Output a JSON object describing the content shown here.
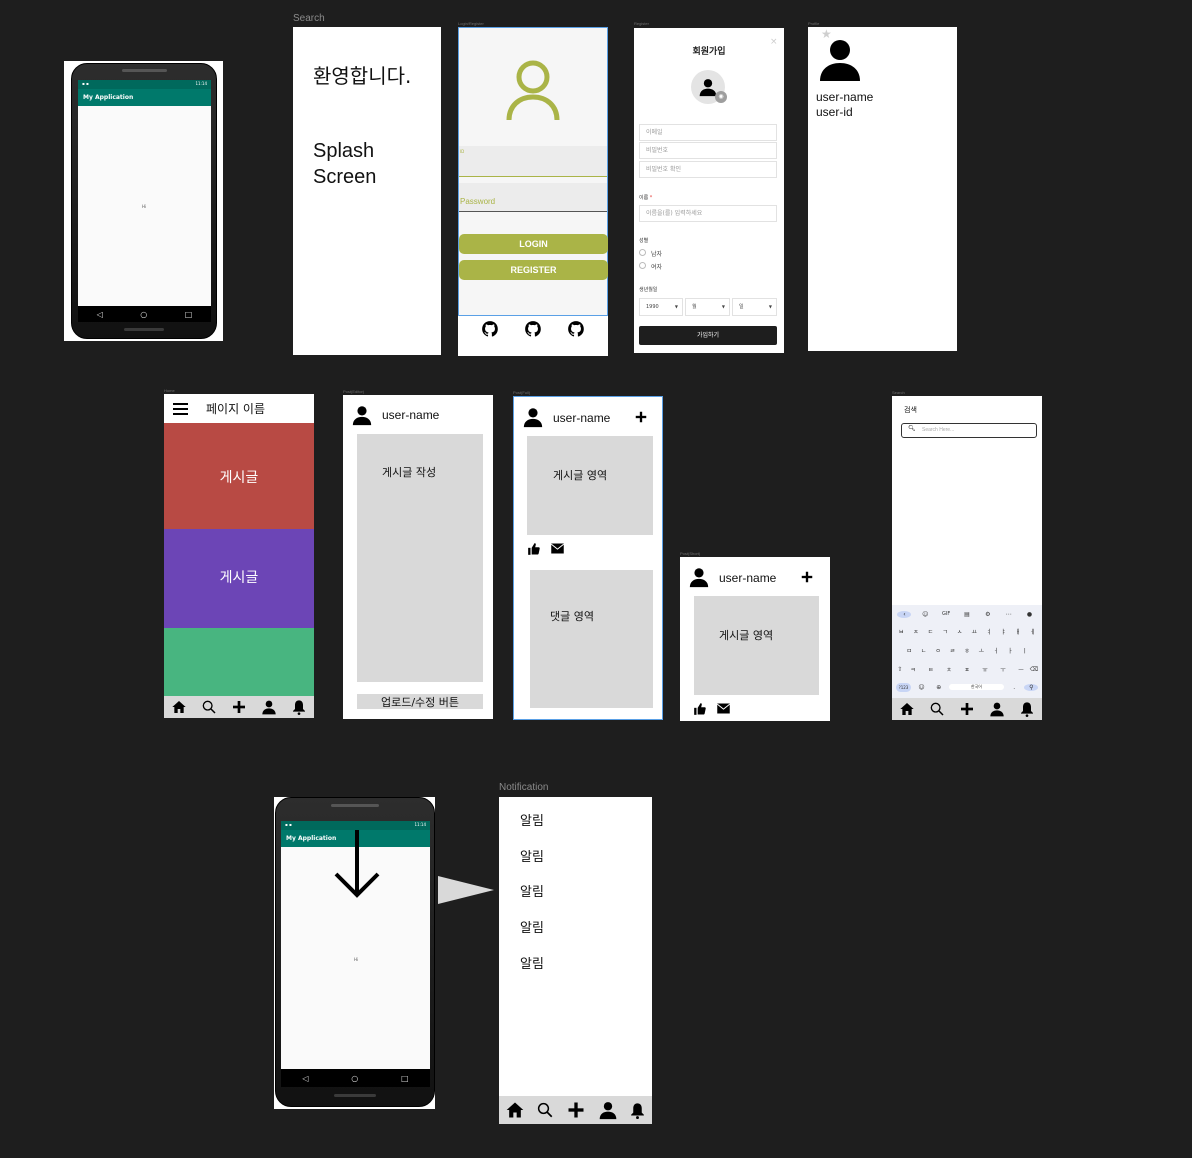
{
  "frames": {
    "search_label": "Search",
    "login_label": "Login/Register",
    "register_label": "Register",
    "profile_label": "Profile",
    "home_label": "Home",
    "post_editor_label": "Post(Editor)",
    "post_full_label": "Post(Full)",
    "post_short_label": "Post(Short)",
    "search2_label": "Search",
    "notification_label": "Notification"
  },
  "phone_top": {
    "app_title": "My Application",
    "status_time": "11:14",
    "center_text": "Hi"
  },
  "phone_bottom": {
    "app_title": "My Application",
    "status_time": "11:14",
    "center_text": "Hi"
  },
  "splash": {
    "welcome": "환영합니다.",
    "line1": "Splash",
    "line2": "Screen"
  },
  "login": {
    "id_label": "ID",
    "password_label": "Password",
    "login_button": "LOGIN",
    "register_button": "REGISTER",
    "accent": "#aab447"
  },
  "register": {
    "title": "회원가입",
    "close": "×",
    "email_placeholder": "이메일",
    "password_placeholder": "비밀번호",
    "password_confirm_placeholder": "비밀번호 확인",
    "name_label": "이름",
    "required_mark": "*",
    "name_placeholder": "이름을(를) 입력하세요",
    "gender_label": "성별",
    "male": "남자",
    "female": "여자",
    "birth_label": "생년월일",
    "year_value": "1990",
    "month_value": "월",
    "day_value": "일",
    "submit": "가입하기"
  },
  "profile": {
    "username": "user-name",
    "userid": "user-id"
  },
  "home": {
    "page_title": "페이지 이름",
    "post1": "게시글",
    "post2": "게시글",
    "colors": [
      "#b84a44",
      "#6c45b6",
      "#48b580"
    ]
  },
  "editor": {
    "username": "user-name",
    "compose": "게시글 작성",
    "upload_button": "업로드/수정 버튼"
  },
  "post_full": {
    "username": "user-name",
    "post_area": "게시글 영역",
    "comment_area": "댓글 영역"
  },
  "post_short": {
    "username": "user-name",
    "post_area": "게시글 영역"
  },
  "search_screen": {
    "title": "검색",
    "placeholder": "Search Here...",
    "kb_toolbar": [
      "GIF",
      "⚙",
      "⋯",
      "🎤"
    ],
    "kb_row1": [
      "ㅂ",
      "ㅈ",
      "ㄷ",
      "ㄱ",
      "ㅅ",
      "ㅛ",
      "ㅕ",
      "ㅑ",
      "ㅐ",
      "ㅔ"
    ],
    "kb_row2": [
      "ㅁ",
      "ㄴ",
      "ㅇ",
      "ㄹ",
      "ㅎ",
      "ㅗ",
      "ㅓ",
      "ㅏ",
      "ㅣ"
    ],
    "kb_row3": [
      "ㅋ",
      "ㅌ",
      "ㅊ",
      "ㅍ",
      "ㅠ",
      "ㅜ",
      "ㅡ"
    ],
    "kb_sym": "?123",
    "kb_space": "한국어",
    "kb_period": "."
  },
  "notification": {
    "items": [
      "알림",
      "알림",
      "알림",
      "알림",
      "알림"
    ]
  },
  "icon_names": [
    "home-icon",
    "search-icon",
    "plus-icon",
    "person-icon",
    "bell-icon",
    "github-icon",
    "thumbs-up-icon",
    "mail-icon",
    "menu-icon",
    "camera-icon",
    "arrow-down-icon",
    "play-arrow-icon"
  ]
}
